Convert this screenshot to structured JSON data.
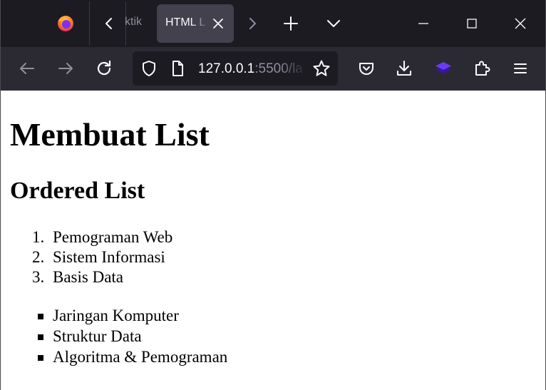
{
  "tabs": {
    "prev_tab_stub": "ktik",
    "active_tab_title": "HTML L"
  },
  "navbar": {
    "url_host": "127.0.0.1",
    "url_rest": ":5500/la"
  },
  "page": {
    "heading": "Membuat List",
    "subheading": "Ordered List",
    "ordered_list": [
      {
        "num": "1.",
        "text": "Pemograman Web"
      },
      {
        "num": "2.",
        "text": "Sistem Informasi"
      },
      {
        "num": "3.",
        "text": "Basis Data"
      }
    ],
    "unordered_list": [
      {
        "text": "Jaringan Komputer"
      },
      {
        "text": "Struktur Data"
      },
      {
        "text": "Algoritma & Pemograman"
      }
    ]
  },
  "icons": {
    "browser_logo": "firefox-logo-icon",
    "scroll_left": "chevron-left-icon",
    "scroll_right": "chevron-right-icon",
    "tab_close": "close-icon",
    "new_tab": "plus-icon",
    "list_all_tabs": "chevron-down-icon",
    "minimize": "minimize-icon",
    "maximize": "maximize-icon",
    "close_window": "close-icon",
    "back": "arrow-left-icon",
    "forward": "arrow-right-icon",
    "reload": "reload-icon",
    "site_security": "shield-icon",
    "page_info": "page-icon",
    "bookmark": "star-icon",
    "pocket": "pocket-icon",
    "downloads": "download-icon",
    "extension": "layers-icon",
    "extensions": "puzzle-icon",
    "app_menu": "hamburger-menu-icon"
  },
  "colors": {
    "tab_strip": "#1c1b22",
    "toolbar": "#2b2a33",
    "active_tab": "#42414d",
    "urlbar": "#1c1b22",
    "icon": "#fbfbfe",
    "icon_disabled": "#8f8f9d",
    "page_background": "#ffffff",
    "extension_accent": "#5b2bd8"
  }
}
